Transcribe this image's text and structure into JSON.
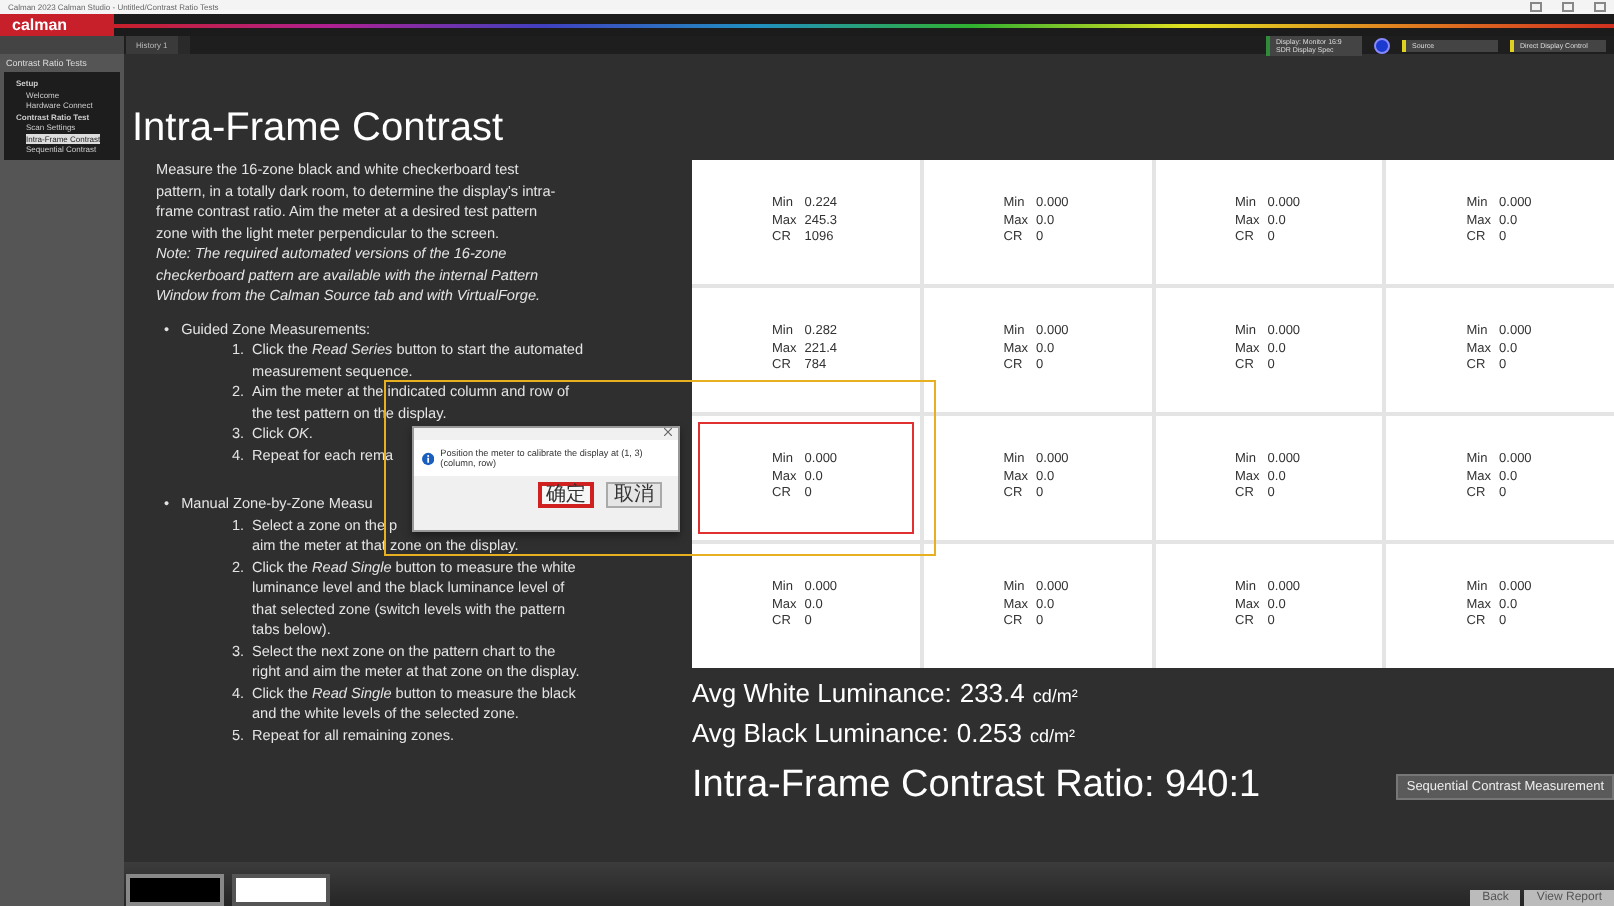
{
  "window": {
    "title": "Calman 2023 Calman Studio - Untitled/Contrast Ratio Tests"
  },
  "app_bar": {
    "logo": "calman"
  },
  "devices": [
    {
      "label": "Display: Monitor 16:9 SDR Display Spec",
      "color": "#2e8b3a"
    },
    {
      "label": "Source",
      "color": "#e0d020"
    },
    {
      "label": "Direct Display Control",
      "color": "#e0d020"
    }
  ],
  "tabs": [
    {
      "label": "History 1",
      "selected": true
    }
  ],
  "sidebar": {
    "title": "Contrast Ratio Tests",
    "tree": [
      {
        "label": "Setup",
        "selected": false,
        "children": [
          {
            "label": "Welcome",
            "selected": false
          },
          {
            "label": "Hardware Connect",
            "selected": false
          }
        ]
      },
      {
        "label": "Contrast Ratio Test",
        "selected": false,
        "children": [
          {
            "label": "Scan Settings",
            "selected": false
          },
          {
            "label": "Intra-Frame Contrast",
            "selected": true
          },
          {
            "label": "Sequential Contrast",
            "selected": false
          }
        ]
      }
    ]
  },
  "page": {
    "title": "Intra-Frame Contrast",
    "intro": [
      "Measure the 16-zone black and white checkerboard test",
      "pattern, in a totally dark room, to determine the display's intra-",
      "frame contrast ratio. Aim the meter at a desired test pattern",
      "zone with the light meter perpendicular to the screen."
    ],
    "note": [
      "Note: The required automated versions of the 16-zone",
      "checkerboard pattern are available with the internal Pattern",
      "Window from the Calman Source tab and with VirtualForge."
    ],
    "sections": [
      {
        "bullet": "•",
        "label": "Guided Zone Measurements:",
        "steps": [
          {
            "number": "1.",
            "lines": [
              "Click the *Read Series* button to start the automated",
              "measurement sequence."
            ]
          },
          {
            "number": "2.",
            "lines": [
              "Aim the meter at the indicated column and row of",
              "the test pattern on the display."
            ]
          },
          {
            "number": "3.",
            "lines": [
              "Click *OK*."
            ]
          },
          {
            "number": "4.",
            "lines": [
              "Repeat for each rema"
            ]
          }
        ]
      },
      {
        "bullet": "•",
        "label": "Manual Zone-by-Zone Measu",
        "steps": [
          {
            "number": "1.",
            "lines": [
              "Select a zone on the p",
              "aim the meter at that zone on the display."
            ]
          },
          {
            "number": "2.",
            "lines": [
              "Click the *Read Single* button to measure the white",
              "luminance level and the black luminance level of",
              "that selected zone (switch levels with the pattern",
              "tabs below)."
            ]
          },
          {
            "number": "3.",
            "lines": [
              "Select the next zone on the pattern chart to the",
              "right and aim the meter at that zone on the display."
            ]
          },
          {
            "number": "4.",
            "lines": [
              "Click the *Read Single* button to measure the black",
              "and the white levels of the selected zone."
            ]
          },
          {
            "number": "5.",
            "lines": [
              "Repeat for all remaining zones."
            ]
          }
        ]
      }
    ]
  },
  "grid": [
    [
      {
        "selected": false,
        "lines": [
          {
            "label": "Min",
            "value": "0.224"
          },
          {
            "label": "Max",
            "value": "245.3"
          },
          {
            "label": "CR",
            "value": "1096"
          }
        ]
      },
      {
        "selected": false,
        "lines": [
          {
            "label": "Min",
            "value": "0.000"
          },
          {
            "label": "Max",
            "value": "0.0"
          },
          {
            "label": "CR",
            "value": "0"
          }
        ]
      },
      {
        "selected": false,
        "lines": [
          {
            "label": "Min",
            "value": "0.000"
          },
          {
            "label": "Max",
            "value": "0.0"
          },
          {
            "label": "CR",
            "value": "0"
          }
        ]
      },
      {
        "selected": false,
        "lines": [
          {
            "label": "Min",
            "value": "0.000"
          },
          {
            "label": "Max",
            "value": "0.0"
          },
          {
            "label": "CR",
            "value": "0"
          }
        ]
      }
    ],
    [
      {
        "selected": false,
        "lines": [
          {
            "label": "Min",
            "value": "0.282"
          },
          {
            "label": "Max",
            "value": "221.4"
          },
          {
            "label": "CR",
            "value": "784"
          }
        ]
      },
      {
        "selected": false,
        "lines": [
          {
            "label": "Min",
            "value": "0.000"
          },
          {
            "label": "Max",
            "value": "0.0"
          },
          {
            "label": "CR",
            "value": "0"
          }
        ]
      },
      {
        "selected": false,
        "lines": [
          {
            "label": "Min",
            "value": "0.000"
          },
          {
            "label": "Max",
            "value": "0.0"
          },
          {
            "label": "CR",
            "value": "0"
          }
        ]
      },
      {
        "selected": false,
        "lines": [
          {
            "label": "Min",
            "value": "0.000"
          },
          {
            "label": "Max",
            "value": "0.0"
          },
          {
            "label": "CR",
            "value": "0"
          }
        ]
      }
    ],
    [
      {
        "selected": true,
        "lines": [
          {
            "label": "Min",
            "value": "0.000"
          },
          {
            "label": "Max",
            "value": "0.0"
          },
          {
            "label": "CR",
            "value": "0"
          }
        ]
      },
      {
        "selected": false,
        "lines": [
          {
            "label": "Min",
            "value": "0.000"
          },
          {
            "label": "Max",
            "value": "0.0"
          },
          {
            "label": "CR",
            "value": "0"
          }
        ]
      },
      {
        "selected": false,
        "lines": [
          {
            "label": "Min",
            "value": "0.000"
          },
          {
            "label": "Max",
            "value": "0.0"
          },
          {
            "label": "CR",
            "value": "0"
          }
        ]
      },
      {
        "selected": false,
        "lines": [
          {
            "label": "Min",
            "value": "0.000"
          },
          {
            "label": "Max",
            "value": "0.0"
          },
          {
            "label": "CR",
            "value": "0"
          }
        ]
      }
    ],
    [
      {
        "selected": false,
        "lines": [
          {
            "label": "Min",
            "value": "0.000"
          },
          {
            "label": "Max",
            "value": "0.0"
          },
          {
            "label": "CR",
            "value": "0"
          }
        ]
      },
      {
        "selected": false,
        "lines": [
          {
            "label": "Min",
            "value": "0.000"
          },
          {
            "label": "Max",
            "value": "0.0"
          },
          {
            "label": "CR",
            "value": "0"
          }
        ]
      },
      {
        "selected": false,
        "lines": [
          {
            "label": "Min",
            "value": "0.000"
          },
          {
            "label": "Max",
            "value": "0.0"
          },
          {
            "label": "CR",
            "value": "0"
          }
        ]
      },
      {
        "selected": false,
        "lines": [
          {
            "label": "Min",
            "value": "0.000"
          },
          {
            "label": "Max",
            "value": "0.0"
          },
          {
            "label": "CR",
            "value": "0"
          }
        ]
      }
    ]
  ],
  "summary": [
    {
      "label": "Avg White Luminance:",
      "value": "233.4",
      "unit": "cd/m²"
    },
    {
      "label": "Avg Black Luminance:",
      "value": "0.253",
      "unit": "cd/m²"
    }
  ],
  "ratio": {
    "label": "Intra-Frame Contrast Ratio:",
    "value": "940:1"
  },
  "sequential_button": "Sequential Contrast Measurement",
  "patterns": [
    {
      "kind": "black",
      "selected": true
    },
    {
      "kind": "white",
      "selected": false
    }
  ],
  "nav": [
    "Back",
    "View Report"
  ],
  "dialog": {
    "message": "Position the meter to calibrate the display at (1, 3) (column, row)",
    "buttons": [
      {
        "label": "确定",
        "focused": true
      },
      {
        "label": "取消",
        "focused": false
      }
    ]
  }
}
